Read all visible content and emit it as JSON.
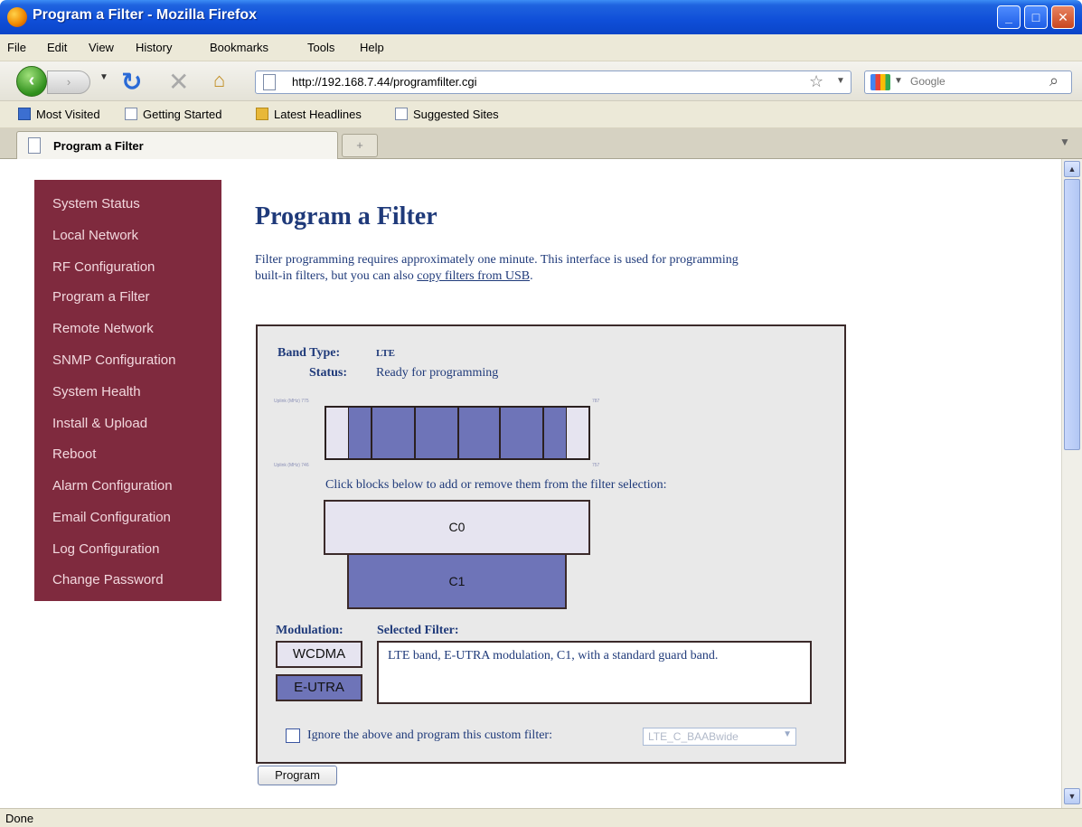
{
  "window": {
    "title": "Program a Filter - Mozilla Firefox"
  },
  "menu": [
    "File",
    "Edit",
    "View",
    "History",
    "Bookmarks",
    "Tools",
    "Help"
  ],
  "nav": {
    "url": "http://192.168.7.44/programfilter.cgi",
    "search_placeholder": "Google"
  },
  "bookmarks": [
    "Most Visited",
    "Getting Started",
    "Latest Headlines",
    "Suggested Sites"
  ],
  "tab": {
    "label": "Program a Filter",
    "new_tab": "+"
  },
  "sidebar": {
    "items": [
      "System Status",
      "Local Network",
      "RF Configuration",
      "Program a Filter",
      "Remote Network",
      "SNMP Configuration",
      "System Health",
      "Install & Upload",
      "Reboot",
      "Alarm Configuration",
      "Email Configuration",
      "Log Configuration",
      "Change Password"
    ]
  },
  "page": {
    "title": "Program a Filter",
    "intro": "Filter programming requires approximately one minute. This interface is used for programming built-in filters, but you can also ",
    "intro_link": "copy filters from USB",
    "intro_end": "."
  },
  "filter": {
    "band_type_label": "Band Type:",
    "band_type_value": "LTE",
    "status_label": "Status:",
    "status_value": "Ready for programming",
    "spectrum_top_left": "Uplink (MHz) 775",
    "spectrum_top_right": "787",
    "spectrum_bottom_left": "Uplink (MHz) 746",
    "spectrum_bottom_right": "757",
    "instruction": "Click blocks below to add or remove them from the filter selection:",
    "blocks": [
      "C0",
      "C1"
    ],
    "modulation_label": "Modulation:",
    "modulations": [
      "WCDMA",
      "E-UTRA"
    ],
    "selected_label": "Selected Filter:",
    "selected_text": "LTE band, E-UTRA modulation, C1, with a standard guard band.",
    "custom_label": "Ignore the above and program this custom filter:",
    "custom_value": "LTE_C_BAABwide"
  },
  "program_button": "Program",
  "status_bar": "Done"
}
